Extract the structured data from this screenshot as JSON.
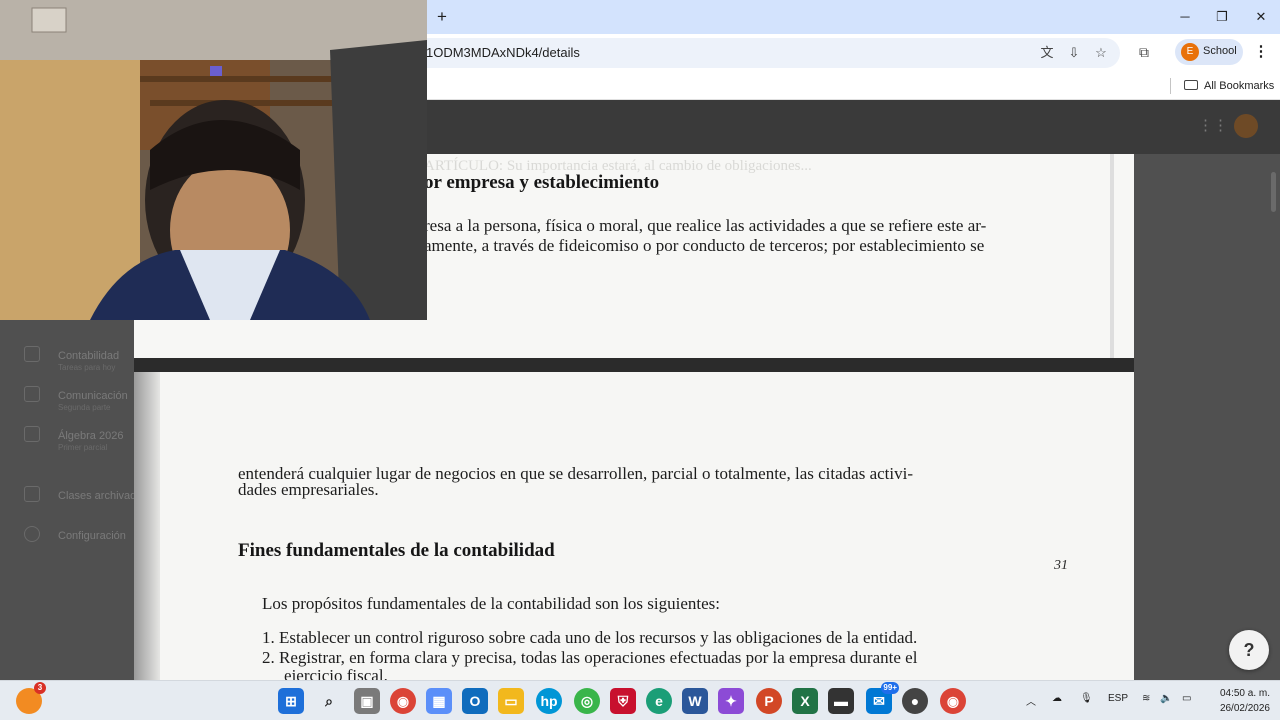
{
  "browser": {
    "url": "1ODM3MDAxNDk4/details",
    "profile_initial": "E",
    "profile_name": "School",
    "all_bookmarks": "All Bookmarks",
    "new_tab": "+",
    "minimize": "─",
    "restore": "❐",
    "close": "✕",
    "menu": "⋮"
  },
  "background_app": {
    "nav_items": [
      {
        "label": "Contabilidad",
        "sub": "Tareas para hoy"
      },
      {
        "label": "Comunicación",
        "sub": "Segunda parte"
      },
      {
        "label": "Álgebra 2026",
        "sub": "Primer parcial"
      },
      {
        "label": "Clases archivadas",
        "sub": ""
      },
      {
        "label": "Configuración",
        "sub": ""
      }
    ]
  },
  "document": {
    "page1": {
      "heading": "or empresa y establecimiento",
      "line1": "resa a la persona, física o moral, que realice las actividades a que se refiere este ar-",
      "line2": "amente, a través de fideicomiso o por conducto de terceros; por establecimiento se"
    },
    "page2": {
      "line1": "entenderá cualquier lugar de negocios en que se desarrollen, parcial o totalmente, las citadas activi-",
      "line2": "dades empresariales.",
      "heading": "Fines fundamentales de la contabilidad",
      "page_number": "31",
      "intro": "Los propósitos fundamentales de la contabilidad son los siguientes:",
      "items": [
        "1. Establecer un control riguroso sobre cada uno de los recursos y las obligaciones de la entidad.",
        "2. Registrar, en forma clara y precisa, todas las operaciones efectuadas por la empresa durante el",
        "ejercicio fiscal."
      ]
    }
  },
  "help_button": "?",
  "taskbar": {
    "start_badge": "3",
    "notif_badge": "99+",
    "language": "ESP",
    "time": "04:50 a. m.",
    "date": "26/02/2026"
  }
}
